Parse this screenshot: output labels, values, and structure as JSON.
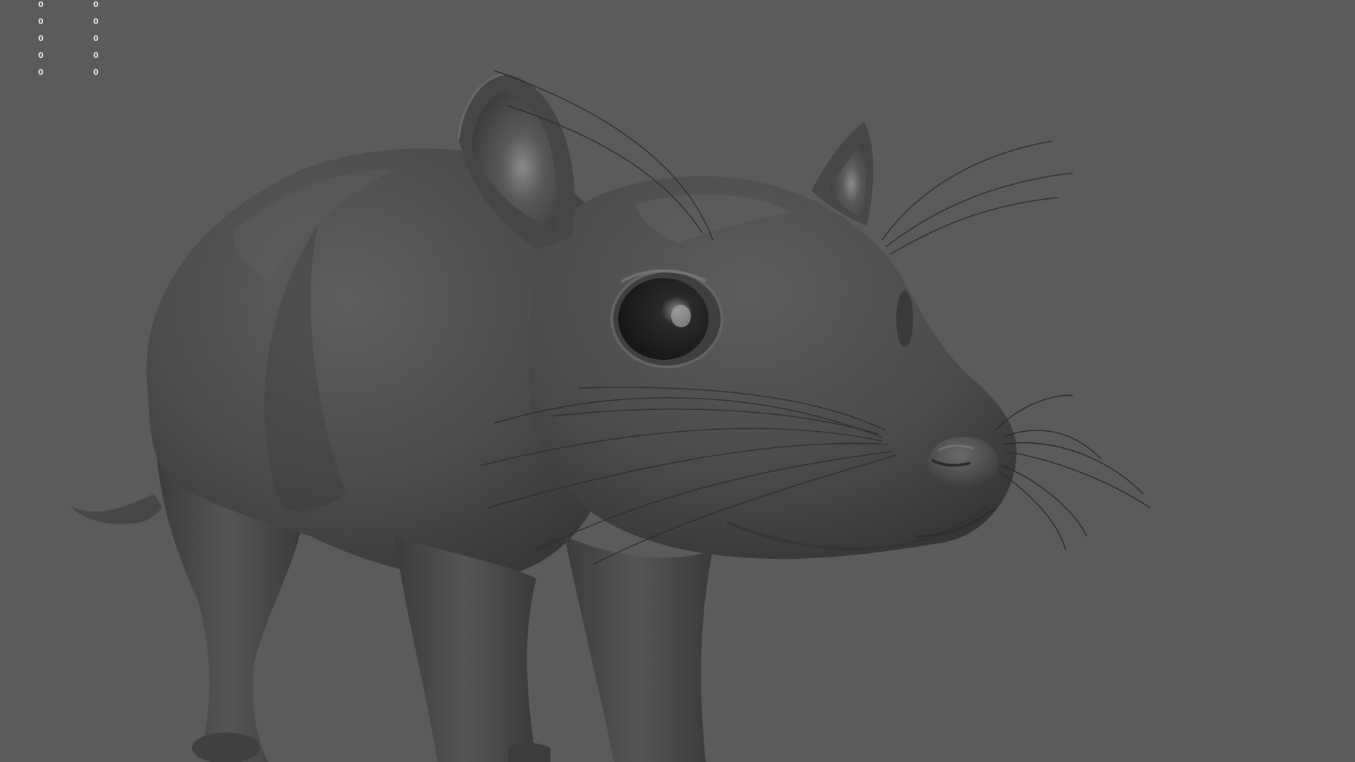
{
  "viewport": {
    "background_color": "#5b5b5b",
    "model_color": "#4a4a4a"
  },
  "hud": {
    "rows": [
      {
        "col_a": "0",
        "col_b": "0"
      },
      {
        "col_a": "0",
        "col_b": "0"
      },
      {
        "col_a": "0",
        "col_b": "0"
      },
      {
        "col_a": "0",
        "col_b": "0"
      },
      {
        "col_a": "0",
        "col_b": "0"
      }
    ]
  }
}
